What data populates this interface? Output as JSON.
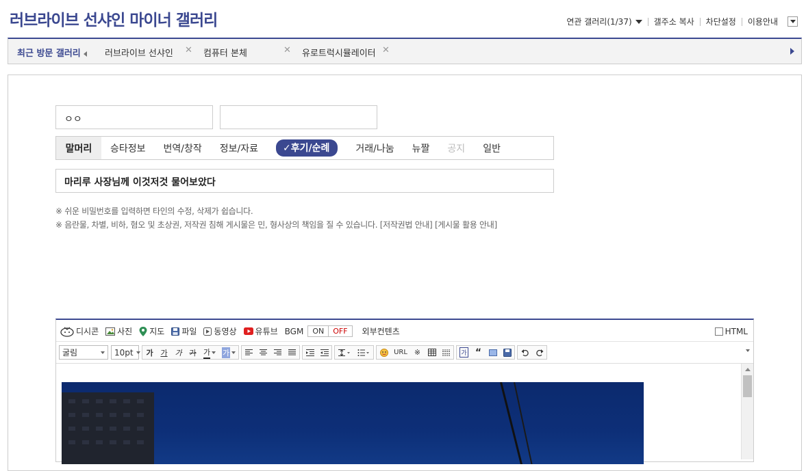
{
  "header": {
    "title": "러브라이브 선샤인 마이너 갤러리",
    "links": [
      "연관 갤러리(1/37)",
      "갤주소 복사",
      "차단설정",
      "이용안내"
    ]
  },
  "recent": {
    "label": "최근 방문 갤러리",
    "items": [
      "러브라이브 선샤인",
      "컴퓨터 본체",
      "유로트럭시뮬레이터"
    ]
  },
  "form": {
    "name_value": "ㅇㅇ",
    "password_value": "",
    "subject_value": "마리루 사장님께 이것저것 물어보았다",
    "category_head": "말머리",
    "categories": [
      "승타정보",
      "번역/창작",
      "정보/자료",
      "✓후기/순례",
      "거래/나눔",
      "뉴짤",
      "공지",
      "일반"
    ],
    "selected_category": "✓후기/순례",
    "notice1": "※ 쉬운 비밀번호를 입력하면 타인의 수정, 삭제가 쉽습니다.",
    "notice2": "※ 음란물, 차별, 비하, 혐오 및 초상권, 저작권 침해 게시물은 민, 형사상의 책임을 질 수 있습니다. [저작권법 안내] [게시물 활용 안내]"
  },
  "editor": {
    "toolbar1": [
      "디시콘",
      "사진",
      "지도",
      "파일",
      "동영상",
      "유튜브",
      "BGM"
    ],
    "bgm_on": "ON",
    "bgm_off": "OFF",
    "external": "외부컨텐츠",
    "html_label": "HTML",
    "font_value": "굴림",
    "size_value": "10pt",
    "url_label": "URL"
  }
}
